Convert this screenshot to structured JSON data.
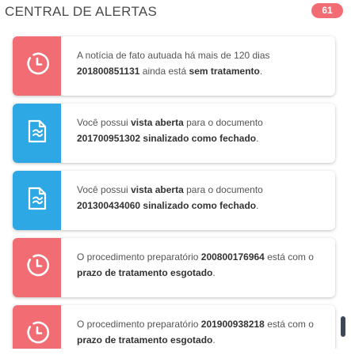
{
  "header": {
    "title": "CENTRAL DE ALERTAS",
    "count": "61"
  },
  "colors": {
    "badge": "#f26d73",
    "clock_alert": "#f26d73",
    "document_alert": "#2da8e4"
  },
  "alerts": [
    {
      "icon": "clock-icon",
      "parts": [
        "A notícia de fato autuada há mais de 120 dias",
        "201800851131",
        "ainda está",
        "sem tratamento",
        "."
      ]
    },
    {
      "icon": "document-icon",
      "parts": [
        "Você possui",
        "vista aberta",
        "para o documento",
        "201700951302 sinalizado como fechado",
        "."
      ]
    },
    {
      "icon": "document-icon",
      "parts": [
        "Você possui",
        "vista aberta",
        "para o documento",
        "201300434060 sinalizado como fechado",
        "."
      ]
    },
    {
      "icon": "clock-icon",
      "parts": [
        "O procedimento preparatório",
        "200800176964",
        "está com o",
        "prazo de tratamento esgotado",
        "."
      ]
    },
    {
      "icon": "clock-icon",
      "parts": [
        "O procedimento preparatório",
        "201900938218",
        "está com o",
        "prazo de tratamento esgotado",
        "."
      ]
    }
  ]
}
